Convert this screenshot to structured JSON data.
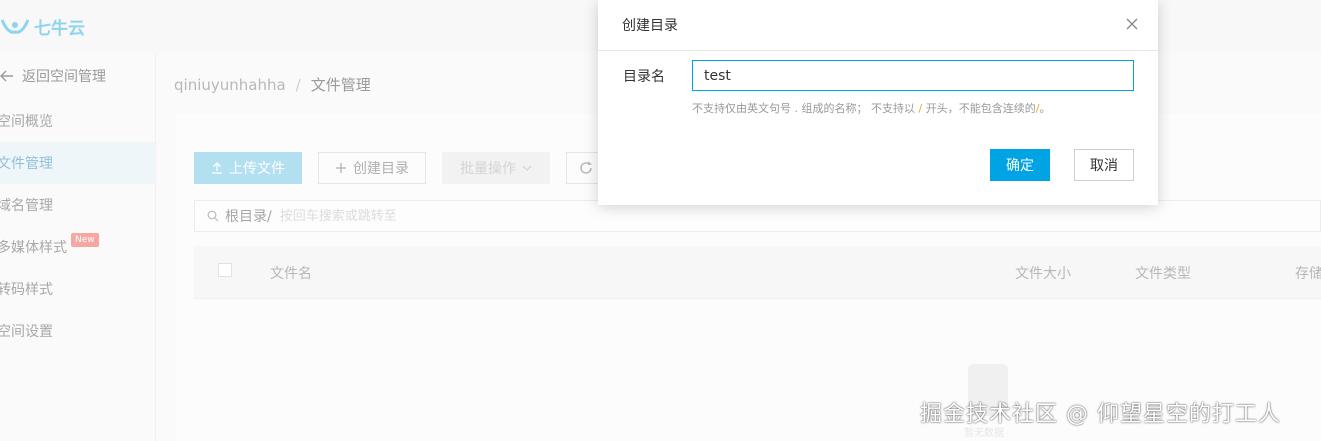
{
  "app": {
    "logo_text": "七牛云",
    "brand_color": "#00a4e4"
  },
  "sidebar": {
    "back_label": "返回空间管理",
    "items": [
      {
        "label": "空间概览",
        "active": false
      },
      {
        "label": "文件管理",
        "active": true
      },
      {
        "label": "域名管理",
        "active": false
      },
      {
        "label": "多媒体样式",
        "active": false,
        "badge": "New"
      },
      {
        "label": "转码样式",
        "active": false
      },
      {
        "label": "空间设置",
        "active": false
      }
    ]
  },
  "breadcrumb": {
    "bucket": "qiniuyunhahha",
    "separator": "/",
    "current": "文件管理"
  },
  "toolbar": {
    "upload_label": "上传文件",
    "mkdir_label": "创建目录",
    "batch_label": "批量操作"
  },
  "search": {
    "root_label": "根目录/",
    "placeholder": "按回车搜索或跳转至"
  },
  "table": {
    "columns": [
      "文件名",
      "文件大小",
      "文件类型",
      "存储"
    ]
  },
  "empty": {
    "text": "暂无数据"
  },
  "watermark": "掘金技术社区 @ 仰望星空的打工人",
  "dialog": {
    "title": "创建目录",
    "field_label": "目录名",
    "field_value": "test",
    "hint_part1": "不支持仅由英文句号",
    "hint_dot": ".",
    "hint_part2": "组成的名称； 不支持以",
    "hint_slash1": "/",
    "hint_part3": "开头，不能包含连续的",
    "hint_slash2": "/",
    "hint_end": "。",
    "ok_label": "确定",
    "cancel_label": "取消"
  }
}
